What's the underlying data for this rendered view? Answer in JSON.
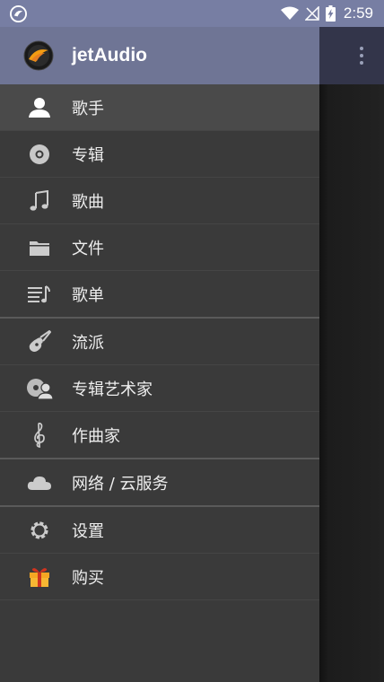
{
  "status_bar": {
    "time": "2:59"
  },
  "app": {
    "title": "jetAudio"
  },
  "menu": [
    {
      "label": "歌手",
      "icon": "person-icon"
    },
    {
      "label": "专辑",
      "icon": "disc-icon"
    },
    {
      "label": "歌曲",
      "icon": "music-note-icon"
    },
    {
      "label": "文件",
      "icon": "folder-icon"
    },
    {
      "label": "歌单",
      "icon": "playlist-icon"
    },
    {
      "label": "流派",
      "icon": "guitar-icon"
    },
    {
      "label": "专辑艺术家",
      "icon": "album-artist-icon"
    },
    {
      "label": "作曲家",
      "icon": "treble-clef-icon"
    },
    {
      "label": "网络 / 云服务",
      "icon": "cloud-icon"
    },
    {
      "label": "设置",
      "icon": "gear-icon"
    },
    {
      "label": "购买",
      "icon": "gift-icon"
    }
  ],
  "colors": {
    "status_bar": "#777ea3",
    "drawer_header": "#6f7595",
    "drawer_bg": "#3a3a3a",
    "selected_item": "#4a4a4a",
    "gift_accent": "#f5a623"
  }
}
